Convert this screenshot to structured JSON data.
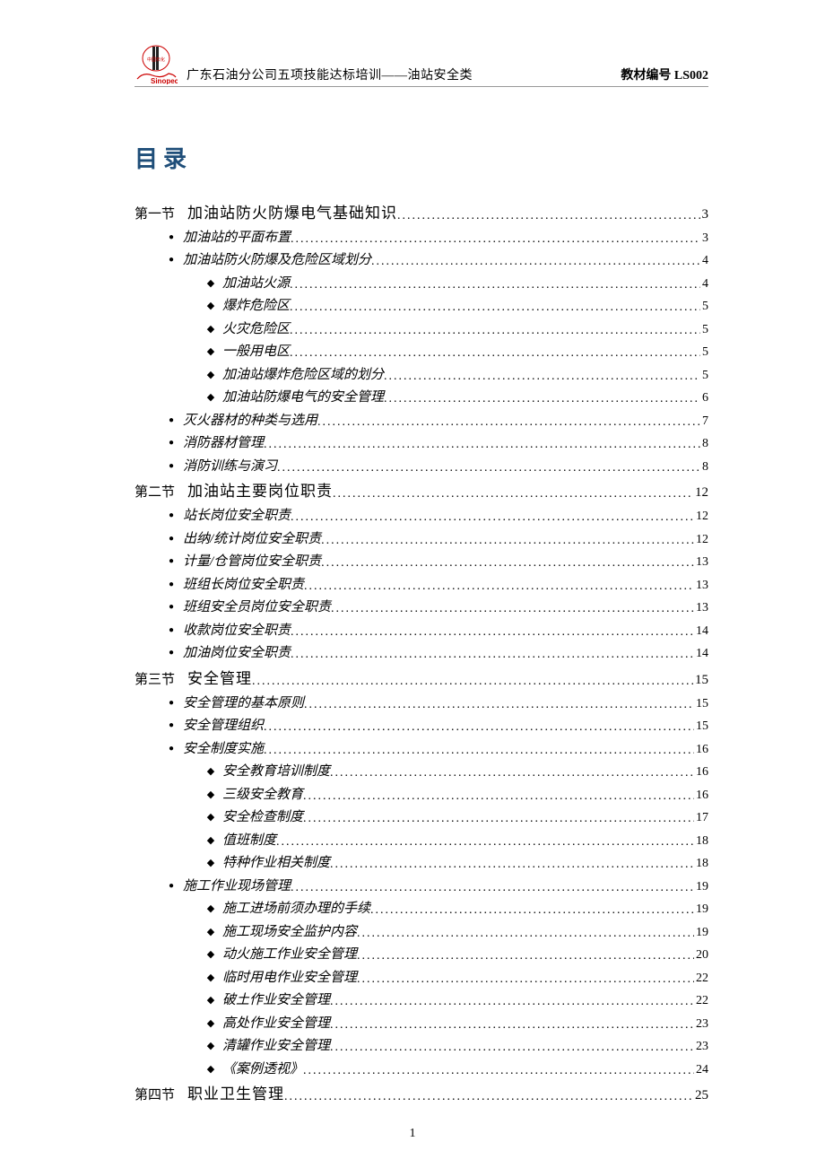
{
  "header": {
    "subtitle": "广东石油分公司五项技能达标培训——油站安全类",
    "code_label": "教材编号 LS002",
    "logo_text_cn": "中国石化",
    "logo_text_en": "Sinopec"
  },
  "toc_title": "目录",
  "page_number": "1",
  "toc": [
    {
      "level": 0,
      "label": "第一节",
      "title": "加油站防火防爆电气基础知识",
      "page": "3"
    },
    {
      "level": 1,
      "title": "加油站的平面布置",
      "page": "3"
    },
    {
      "level": 1,
      "title": "加油站防火防爆及危险区域划分",
      "page": "4"
    },
    {
      "level": 2,
      "title": "加油站火源",
      "page": "4"
    },
    {
      "level": 2,
      "title": "爆炸危险区",
      "page": "5"
    },
    {
      "level": 2,
      "title": "火灾危险区",
      "page": "5"
    },
    {
      "level": 2,
      "title": "一般用电区",
      "page": "5"
    },
    {
      "level": 2,
      "title": "加油站爆炸危险区域的划分",
      "page": "5"
    },
    {
      "level": 2,
      "title": "加油站防爆电气的安全管理",
      "page": "6"
    },
    {
      "level": 1,
      "title": "灭火器材的种类与选用",
      "page": "7"
    },
    {
      "level": 1,
      "title": "消防器材管理",
      "page": "8"
    },
    {
      "level": 1,
      "title": "消防训练与演习",
      "page": "8"
    },
    {
      "level": 0,
      "label": "第二节",
      "title": "加油站主要岗位职责",
      "page": "12"
    },
    {
      "level": 1,
      "title": "站长岗位安全职责",
      "page": "12"
    },
    {
      "level": 1,
      "title": "出纳/统计岗位安全职责",
      "page": "12"
    },
    {
      "level": 1,
      "title": "计量/仓管岗位安全职责",
      "page": "13"
    },
    {
      "level": 1,
      "title": "班组长岗位安全职责",
      "page": "13"
    },
    {
      "level": 1,
      "title": "班组安全员岗位安全职责",
      "page": "13"
    },
    {
      "level": 1,
      "title": "收款岗位安全职责",
      "page": "14"
    },
    {
      "level": 1,
      "title": "加油岗位安全职责",
      "page": "14"
    },
    {
      "level": 0,
      "label": "第三节",
      "title": "安全管理",
      "page": "15"
    },
    {
      "level": 1,
      "title": "安全管理的基本原则",
      "page": "15"
    },
    {
      "level": 1,
      "title": "安全管理组织",
      "page": "15"
    },
    {
      "level": 1,
      "title": "安全制度实施",
      "page": "16"
    },
    {
      "level": 2,
      "title": "安全教育培训制度",
      "page": "16"
    },
    {
      "level": 2,
      "title": "三级安全教育",
      "page": "16"
    },
    {
      "level": 2,
      "title": "安全检查制度",
      "page": "17"
    },
    {
      "level": 2,
      "title": "值班制度",
      "page": "18"
    },
    {
      "level": 2,
      "title": "特种作业相关制度",
      "page": "18"
    },
    {
      "level": 1,
      "title": "施工作业现场管理",
      "page": "19"
    },
    {
      "level": 2,
      "title": "施工进场前须办理的手续",
      "page": "19"
    },
    {
      "level": 2,
      "title": "施工现场安全监护内容",
      "page": "19"
    },
    {
      "level": 2,
      "title": "动火施工作业安全管理",
      "page": "20"
    },
    {
      "level": 2,
      "title": "临时用电作业安全管理",
      "page": "22"
    },
    {
      "level": 2,
      "title": "破土作业安全管理",
      "page": "22"
    },
    {
      "level": 2,
      "title": "高处作业安全管理",
      "page": "23"
    },
    {
      "level": 2,
      "title": "清罐作业安全管理",
      "page": "23"
    },
    {
      "level": 2,
      "title": "《案例透视》",
      "page": "24"
    },
    {
      "level": 0,
      "label": "第四节",
      "title": "职业卫生管理",
      "page": "25"
    }
  ]
}
